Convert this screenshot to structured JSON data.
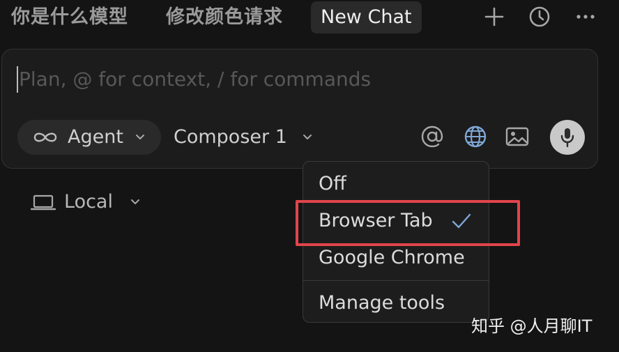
{
  "tabs": [
    {
      "label": "你是什么模型",
      "active": false
    },
    {
      "label": "修改颜色请求",
      "active": false
    },
    {
      "label": "New Chat",
      "active": true
    }
  ],
  "top_icons": [
    "plus-icon",
    "history-clock-icon",
    "more-ellipsis-icon"
  ],
  "composer": {
    "placeholder": "Plan, @ for context, / for commands",
    "value": "",
    "mode_label": "Agent",
    "model_label": "Composer 1",
    "toolbar_icons": [
      "at-mention-icon",
      "globe-icon",
      "image-icon",
      "microphone-icon"
    ]
  },
  "environment": {
    "label": "Local",
    "icon": "laptop-icon"
  },
  "browser_menu": {
    "items": [
      {
        "label": "Off",
        "selected": false
      },
      {
        "label": "Browser Tab",
        "selected": true
      },
      {
        "label": "Google Chrome",
        "selected": false
      },
      {
        "label": "Manage tools",
        "selected": false
      }
    ]
  },
  "watermark": "知乎 @人月聊IT",
  "colors": {
    "background": "#141414",
    "panel": "#1c1c1c",
    "pill": "#2a2a2a",
    "highlight": "#e0454b",
    "check": "#7fa7d6"
  }
}
